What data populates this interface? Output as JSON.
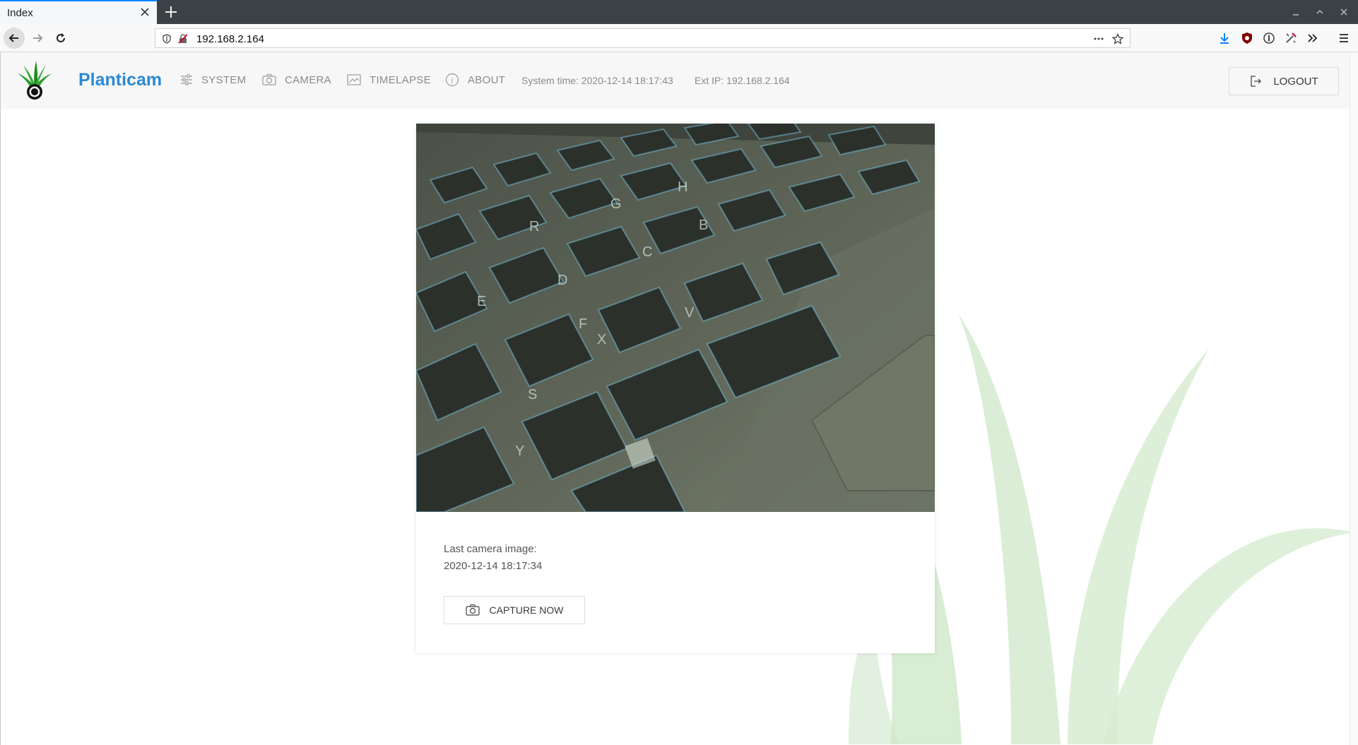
{
  "browser": {
    "tab_title": "Index",
    "url": "192.168.2.164"
  },
  "header": {
    "brand": "Planticam",
    "nav": [
      {
        "label": "SYSTEM",
        "icon": "sliders-icon"
      },
      {
        "label": "CAMERA",
        "icon": "camera-icon"
      },
      {
        "label": "TIMELAPSE",
        "icon": "image-icon"
      },
      {
        "label": "ABOUT",
        "icon": "info-icon"
      }
    ],
    "system_time": "System time: 2020-12-14 18:17:43",
    "ext_ip": "Ext IP: 192.168.2.164",
    "logout_label": "LOGOUT"
  },
  "card": {
    "last_image_label": "Last camera image:",
    "last_image_time": "2020-12-14 18:17:34",
    "capture_label": "CAPTURE NOW"
  },
  "colors": {
    "brand": "#2a8ad4",
    "nav_text": "#8a8a8a",
    "tab_accent": "#0a84ff",
    "plant_bg": "#d6ecd0"
  }
}
